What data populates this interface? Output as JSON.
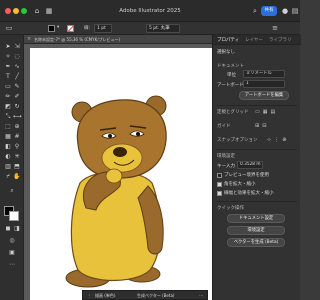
{
  "app": {
    "title": "Adobe Illustrator 2025",
    "share_label": "共有"
  },
  "control_bar": {
    "stroke_label": "線:",
    "stroke_width": "1 pt",
    "brush_value": "5 pt. 丸筆"
  },
  "document": {
    "tab_label": "名称未設定-7* @ 55,36 % (CMYK/プレビュー)"
  },
  "panel": {
    "tabs": [
      "プロパティ",
      "レイヤー",
      "ライブラリ"
    ],
    "no_selection": "選択なし",
    "document_heading": "ドキュメント",
    "units_label": "単位",
    "units_value": "ミリメートル",
    "artboard_label": "アートボード",
    "artboard_value": "1",
    "edit_artboard_button": "アートボードを編集",
    "rulers_grid_heading": "定規とグリッド",
    "guides_heading": "ガイド",
    "snap_heading": "スナップオプション",
    "preferences_heading": "環境設定",
    "key_increment_label": "キー入力",
    "key_increment_value": "0.3528 m",
    "preview_bounds_label": "プレビュー境界を使用",
    "scale_corners_label": "角を拡大・縮小",
    "scale_strokes_label": "線幅と効果を拡大・縮小",
    "quick_actions_heading": "クイック操作",
    "document_setup_button": "ドキュメント設定",
    "preferences_button": "環境設定",
    "generate_vectors_button": "ベクターを生成 (Beta)"
  },
  "bottom_bar": {
    "recolor_label": "描画 (単色)",
    "generate_label": "生成ベクター (Beta)"
  },
  "colors": {
    "panel_bg": "#323232",
    "accent_blue": "#2a6fdb",
    "bear_fill": "#e8c23a",
    "bear_brown": "#9a6a2c"
  },
  "illustration": {
    "subject": "cartoon bear with paw on chin"
  }
}
